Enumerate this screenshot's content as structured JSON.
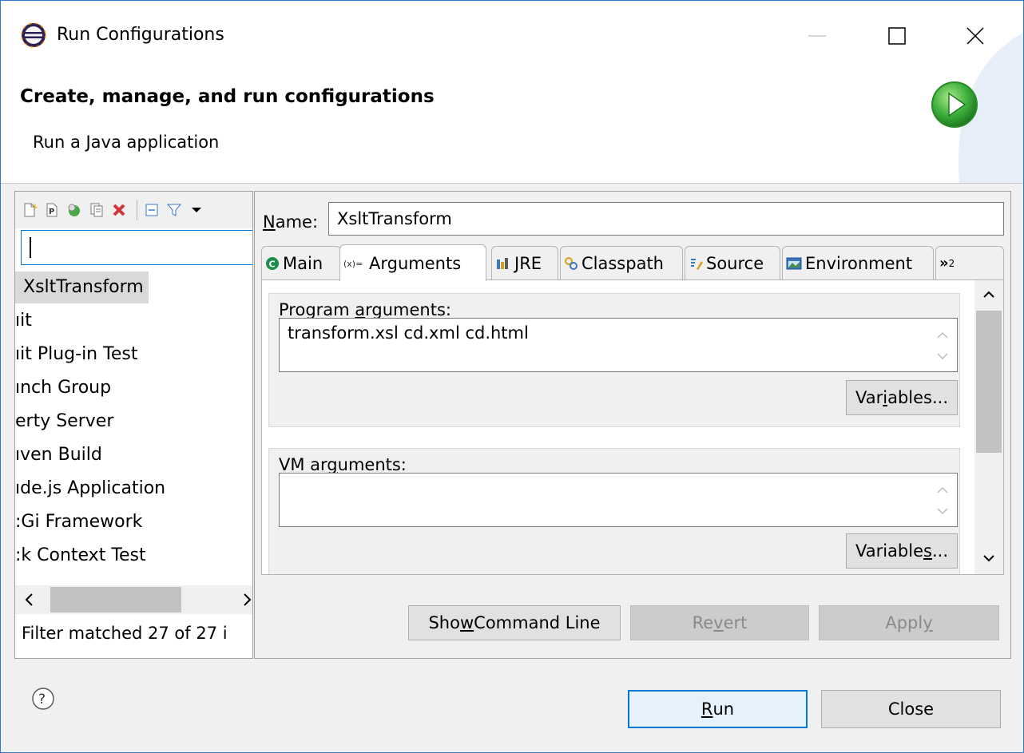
{
  "window": {
    "title": "Run Configurations",
    "header_title": "Create, manage, and run configurations",
    "header_subtitle": "Run a Java application"
  },
  "left": {
    "filter_value": "",
    "items": [
      "XsltTransform",
      "ıit",
      "ıit Plug-in Test",
      "ınch Group",
      "erty Server",
      "ıven Build",
      "ıde.js Application",
      ":Gi Framework",
      ":k Context Test"
    ],
    "selected_index": 0,
    "filter_status": "Filter matched 27 of 27 i",
    "toolbar_icons": [
      "new-config-icon",
      "new-prototype-icon",
      "export-icon",
      "duplicate-icon",
      "delete-icon",
      "collapse-all-icon",
      "filter-icon",
      "view-menu-icon"
    ]
  },
  "right": {
    "name_label": "Name:",
    "name_value": "XsltTransform",
    "tabs": [
      {
        "label": "Main",
        "icon": "main-tab-icon"
      },
      {
        "label": "Arguments",
        "icon": "arguments-tab-icon"
      },
      {
        "label": "JRE",
        "icon": "jre-tab-icon"
      },
      {
        "label": "Classpath",
        "icon": "classpath-tab-icon"
      },
      {
        "label": "Source",
        "icon": "source-tab-icon"
      },
      {
        "label": "Environment",
        "icon": "environment-tab-icon"
      }
    ],
    "more_tabs": "»",
    "more_tabs_count": "2",
    "active_tab": "Arguments",
    "program_args_label": "Program arguments:",
    "program_args_value": "transform.xsl cd.xml cd.html",
    "vm_args_label": "VM arguments:",
    "vm_args_value": "",
    "variables_label": "Variables...",
    "show_command_line": "Show Command Line",
    "revert": "Revert",
    "apply": "Apply"
  },
  "footer": {
    "run": "Run",
    "close": "Close"
  },
  "colors": {
    "accent": "#0078d7",
    "window_border": "#2b7ad1",
    "delete_red": "#d13438",
    "run_green": "#3cb03c"
  }
}
